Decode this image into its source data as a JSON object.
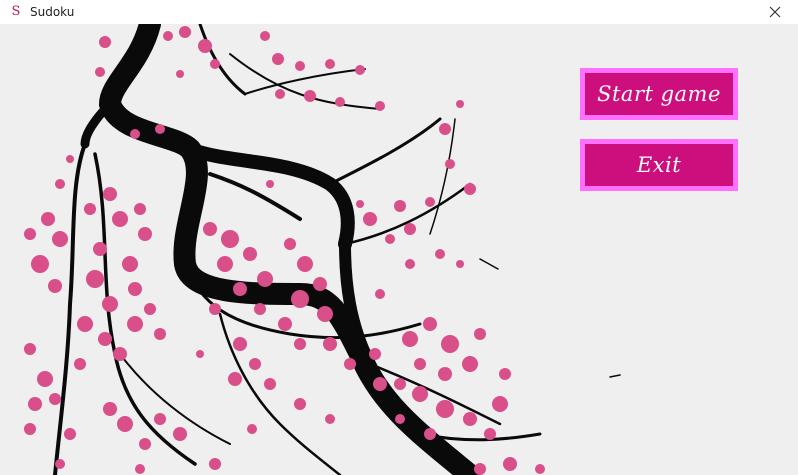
{
  "window": {
    "title": "Sudoku",
    "icon": "sudoku-s-icon",
    "icon_glyph": "S",
    "close_icon": "close-icon"
  },
  "menu": {
    "start_label": "Start game",
    "exit_label": "Exit"
  },
  "colors": {
    "button_fill": "#cc0f7c",
    "button_border": "#ff70ff",
    "blossom": "#d94f8a",
    "branch": "#0a0a0a",
    "background": "#efefef"
  },
  "decoration": {
    "illustration": "cherry-blossom-branch"
  }
}
